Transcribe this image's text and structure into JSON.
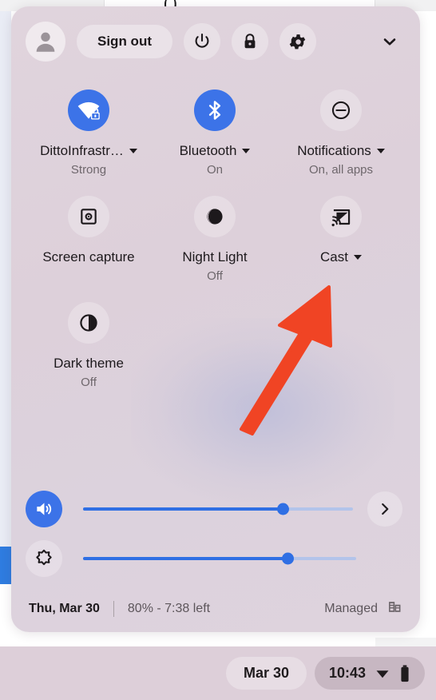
{
  "panel": {
    "name": "chromeos-quick-settings",
    "background_color": "#ddd0da",
    "accent_color": "#3c73e8",
    "annotation_color": "#f04424"
  },
  "header": {
    "avatar_icon": "user-avatar-icon",
    "sign_out_label": "Sign out",
    "power_icon": "power-icon",
    "lock_icon": "lock-icon",
    "settings_icon": "gear-icon",
    "collapse_icon": "chevron-down-icon"
  },
  "tiles": [
    {
      "name": "network",
      "icon": "wifi-locked-icon",
      "label": "DittoInfrastr…",
      "sublabel": "Strong",
      "state": "on",
      "has_caret": true
    },
    {
      "name": "bluetooth",
      "icon": "bluetooth-icon",
      "label": "Bluetooth",
      "sublabel": "On",
      "state": "on",
      "has_caret": true
    },
    {
      "name": "notifications",
      "icon": "do-not-disturb-icon",
      "label": "Notifications",
      "sublabel": "On, all apps",
      "state": "off",
      "has_caret": true
    },
    {
      "name": "screen-capture",
      "icon": "screen-capture-icon",
      "label": "Screen capture",
      "sublabel": "",
      "state": "off",
      "has_caret": false
    },
    {
      "name": "night-light",
      "icon": "night-light-icon",
      "label": "Night Light",
      "sublabel": "Off",
      "state": "off",
      "has_caret": false
    },
    {
      "name": "cast",
      "icon": "cast-icon",
      "label": "Cast",
      "sublabel": "",
      "state": "off",
      "has_caret": true
    },
    {
      "name": "dark-theme",
      "icon": "dark-theme-icon",
      "label": "Dark theme",
      "sublabel": "Off",
      "state": "off",
      "has_caret": false
    }
  ],
  "sliders": [
    {
      "name": "volume",
      "icon": "volume-up-icon",
      "icon_state": "on",
      "value_percent": 74,
      "trailing_icon": "chevron-right-icon",
      "has_trailing": true
    },
    {
      "name": "brightness",
      "icon": "brightness-icon",
      "icon_state": "off",
      "value_percent": 75,
      "trailing_icon": "",
      "has_trailing": false
    }
  ],
  "footer": {
    "date": "Thu, Mar 30",
    "battery": "80% - 7:38 left",
    "managed_label": "Managed",
    "managed_icon": "enterprise-building-icon"
  },
  "shelf": {
    "date_pill": "Mar 30",
    "time": "10:43",
    "network_icon": "wifi-icon",
    "battery_icon": "battery-icon"
  },
  "annotation": {
    "name": "pointer-arrow",
    "target": "cast",
    "color": "#f04424"
  }
}
